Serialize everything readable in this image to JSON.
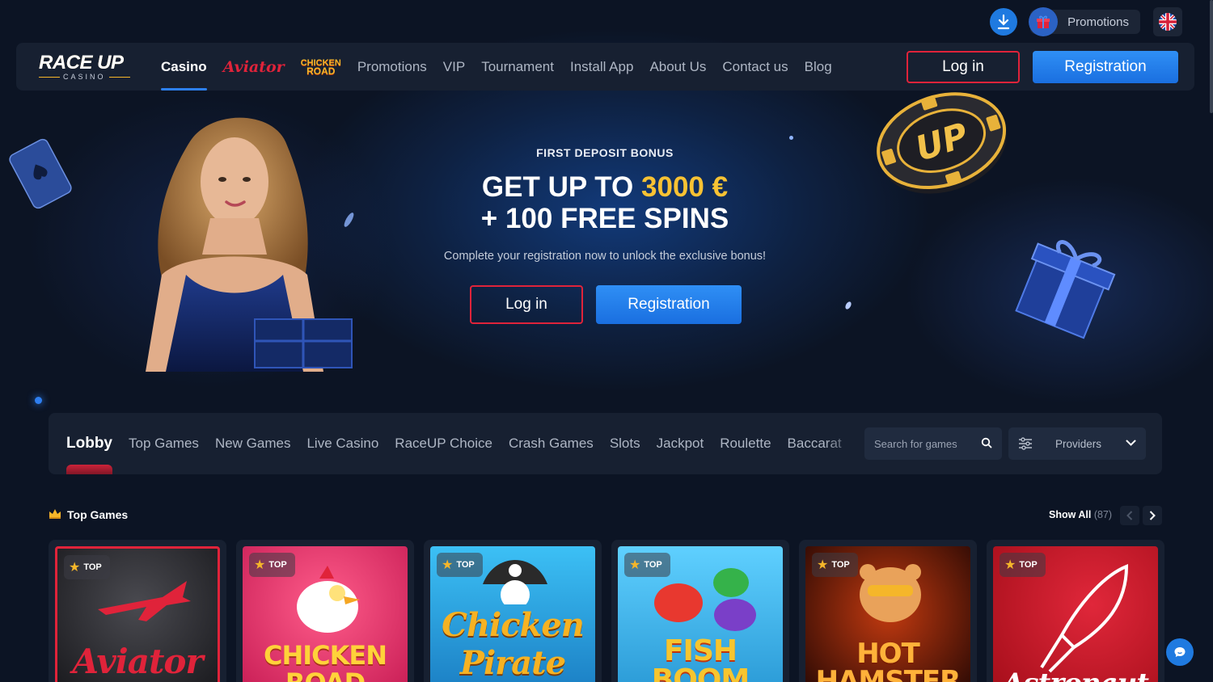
{
  "util": {
    "promotions_label": "Promotions"
  },
  "nav": {
    "logo_text": "RACE UP",
    "logo_sub": "CASINO",
    "items": [
      "Casino",
      "Promotions",
      "VIP",
      "Tournament",
      "Install App",
      "About Us",
      "Contact us",
      "Blog"
    ],
    "aviator_label": "Aviator",
    "chicken_label_1": "CHICKEN",
    "chicken_label_2": "ROAD",
    "login_label": "Log in",
    "register_label": "Registration"
  },
  "hero": {
    "subtitle": "FIRST DEPOSIT BONUS",
    "title_prefix": "GET UP TO ",
    "title_amount": "3000 €",
    "title_line2": "+ 100 FREE SPINS",
    "description": "Complete your registration now to unlock the exclusive bonus!",
    "login_label": "Log in",
    "register_label": "Registration",
    "coin_text": "UP"
  },
  "categories": {
    "tabs": [
      "Lobby",
      "Top Games",
      "New Games",
      "Live Casino",
      "RaceUP Choice",
      "Crash Games",
      "Slots",
      "Jackpot",
      "Roulette",
      "Baccarat"
    ],
    "search_placeholder": "Search for games",
    "providers_label": "Providers"
  },
  "top_games": {
    "title": "Top Games",
    "show_all_label": "Show All",
    "show_all_count": "(87)",
    "badge": "TOP",
    "games": [
      {
        "name": "Aviator",
        "bg": "#2a2a2e",
        "accent": "#e0233a"
      },
      {
        "name": "CHICKEN ROAD",
        "bg": "#e8376e",
        "accent": "#ffd23a"
      },
      {
        "name": "Chicken Pirate",
        "bg": "#2aa9e6",
        "accent": "#f6b223"
      },
      {
        "name": "FISH BOOM",
        "bg": "#3fb6ea",
        "accent": "#f6c52f"
      },
      {
        "name": "HOT HAMSTER",
        "bg": "#4a1206",
        "accent": "#ff9a1f"
      },
      {
        "name": "Astronaut",
        "bg": "#c7121f",
        "accent": "#ffffff"
      }
    ]
  }
}
